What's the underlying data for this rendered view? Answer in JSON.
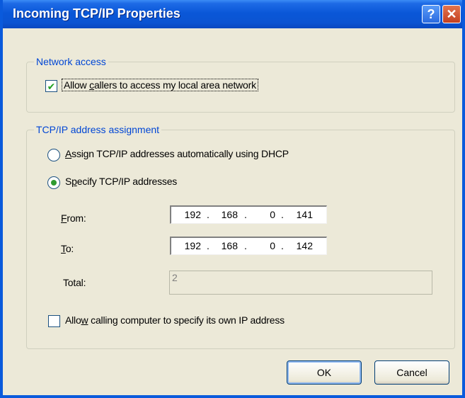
{
  "window": {
    "title": "Incoming TCP/IP Properties",
    "help_glyph": "?",
    "close_glyph": "✕"
  },
  "network_access": {
    "legend": "Network access",
    "allow_lan": {
      "checked": true,
      "label_pre": "Allow ",
      "label_key": "c",
      "label_post": "allers to access my local area network"
    }
  },
  "tcpip": {
    "legend": "TCP/IP address assignment",
    "radio_auto": {
      "selected": false,
      "label_key": "A",
      "label_post": "ssign TCP/IP addresses automatically using DHCP"
    },
    "radio_specify": {
      "selected": true,
      "label_pre": "S",
      "label_key": "p",
      "label_post": "ecify TCP/IP addresses"
    },
    "from": {
      "label_key": "F",
      "label_post": "rom:",
      "octets": [
        "192",
        "168",
        "0",
        "141"
      ]
    },
    "to": {
      "label_key": "T",
      "label_post": "o:",
      "octets": [
        "192",
        "168",
        "0",
        "142"
      ]
    },
    "total": {
      "label": "Total:",
      "value": "2"
    },
    "allow_own_ip": {
      "checked": false,
      "label_pre": "Allo",
      "label_key": "w",
      "label_post": " calling computer to specify its own IP address"
    }
  },
  "buttons": {
    "ok": "OK",
    "cancel": "Cancel"
  },
  "colors": {
    "title_bar": "#0a57d8",
    "legend_text": "#0046d5",
    "dialog_bg": "#ece9d8"
  }
}
